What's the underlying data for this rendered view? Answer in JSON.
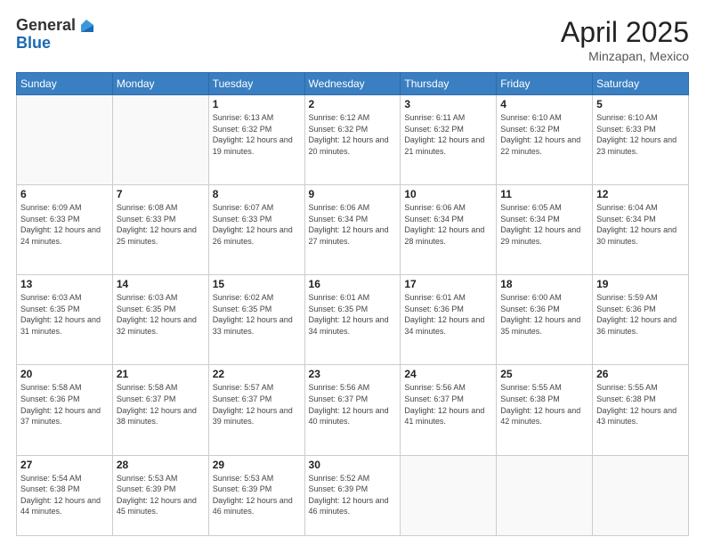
{
  "header": {
    "logo_line1": "General",
    "logo_line2": "Blue",
    "title": "April 2025",
    "location": "Minzapan, Mexico"
  },
  "days_of_week": [
    "Sunday",
    "Monday",
    "Tuesday",
    "Wednesday",
    "Thursday",
    "Friday",
    "Saturday"
  ],
  "weeks": [
    [
      {
        "day": null,
        "sunrise": null,
        "sunset": null,
        "daylight": null
      },
      {
        "day": null,
        "sunrise": null,
        "sunset": null,
        "daylight": null
      },
      {
        "day": "1",
        "sunrise": "Sunrise: 6:13 AM",
        "sunset": "Sunset: 6:32 PM",
        "daylight": "Daylight: 12 hours and 19 minutes."
      },
      {
        "day": "2",
        "sunrise": "Sunrise: 6:12 AM",
        "sunset": "Sunset: 6:32 PM",
        "daylight": "Daylight: 12 hours and 20 minutes."
      },
      {
        "day": "3",
        "sunrise": "Sunrise: 6:11 AM",
        "sunset": "Sunset: 6:32 PM",
        "daylight": "Daylight: 12 hours and 21 minutes."
      },
      {
        "day": "4",
        "sunrise": "Sunrise: 6:10 AM",
        "sunset": "Sunset: 6:32 PM",
        "daylight": "Daylight: 12 hours and 22 minutes."
      },
      {
        "day": "5",
        "sunrise": "Sunrise: 6:10 AM",
        "sunset": "Sunset: 6:33 PM",
        "daylight": "Daylight: 12 hours and 23 minutes."
      }
    ],
    [
      {
        "day": "6",
        "sunrise": "Sunrise: 6:09 AM",
        "sunset": "Sunset: 6:33 PM",
        "daylight": "Daylight: 12 hours and 24 minutes."
      },
      {
        "day": "7",
        "sunrise": "Sunrise: 6:08 AM",
        "sunset": "Sunset: 6:33 PM",
        "daylight": "Daylight: 12 hours and 25 minutes."
      },
      {
        "day": "8",
        "sunrise": "Sunrise: 6:07 AM",
        "sunset": "Sunset: 6:33 PM",
        "daylight": "Daylight: 12 hours and 26 minutes."
      },
      {
        "day": "9",
        "sunrise": "Sunrise: 6:06 AM",
        "sunset": "Sunset: 6:34 PM",
        "daylight": "Daylight: 12 hours and 27 minutes."
      },
      {
        "day": "10",
        "sunrise": "Sunrise: 6:06 AM",
        "sunset": "Sunset: 6:34 PM",
        "daylight": "Daylight: 12 hours and 28 minutes."
      },
      {
        "day": "11",
        "sunrise": "Sunrise: 6:05 AM",
        "sunset": "Sunset: 6:34 PM",
        "daylight": "Daylight: 12 hours and 29 minutes."
      },
      {
        "day": "12",
        "sunrise": "Sunrise: 6:04 AM",
        "sunset": "Sunset: 6:34 PM",
        "daylight": "Daylight: 12 hours and 30 minutes."
      }
    ],
    [
      {
        "day": "13",
        "sunrise": "Sunrise: 6:03 AM",
        "sunset": "Sunset: 6:35 PM",
        "daylight": "Daylight: 12 hours and 31 minutes."
      },
      {
        "day": "14",
        "sunrise": "Sunrise: 6:03 AM",
        "sunset": "Sunset: 6:35 PM",
        "daylight": "Daylight: 12 hours and 32 minutes."
      },
      {
        "day": "15",
        "sunrise": "Sunrise: 6:02 AM",
        "sunset": "Sunset: 6:35 PM",
        "daylight": "Daylight: 12 hours and 33 minutes."
      },
      {
        "day": "16",
        "sunrise": "Sunrise: 6:01 AM",
        "sunset": "Sunset: 6:35 PM",
        "daylight": "Daylight: 12 hours and 34 minutes."
      },
      {
        "day": "17",
        "sunrise": "Sunrise: 6:01 AM",
        "sunset": "Sunset: 6:36 PM",
        "daylight": "Daylight: 12 hours and 34 minutes."
      },
      {
        "day": "18",
        "sunrise": "Sunrise: 6:00 AM",
        "sunset": "Sunset: 6:36 PM",
        "daylight": "Daylight: 12 hours and 35 minutes."
      },
      {
        "day": "19",
        "sunrise": "Sunrise: 5:59 AM",
        "sunset": "Sunset: 6:36 PM",
        "daylight": "Daylight: 12 hours and 36 minutes."
      }
    ],
    [
      {
        "day": "20",
        "sunrise": "Sunrise: 5:58 AM",
        "sunset": "Sunset: 6:36 PM",
        "daylight": "Daylight: 12 hours and 37 minutes."
      },
      {
        "day": "21",
        "sunrise": "Sunrise: 5:58 AM",
        "sunset": "Sunset: 6:37 PM",
        "daylight": "Daylight: 12 hours and 38 minutes."
      },
      {
        "day": "22",
        "sunrise": "Sunrise: 5:57 AM",
        "sunset": "Sunset: 6:37 PM",
        "daylight": "Daylight: 12 hours and 39 minutes."
      },
      {
        "day": "23",
        "sunrise": "Sunrise: 5:56 AM",
        "sunset": "Sunset: 6:37 PM",
        "daylight": "Daylight: 12 hours and 40 minutes."
      },
      {
        "day": "24",
        "sunrise": "Sunrise: 5:56 AM",
        "sunset": "Sunset: 6:37 PM",
        "daylight": "Daylight: 12 hours and 41 minutes."
      },
      {
        "day": "25",
        "sunrise": "Sunrise: 5:55 AM",
        "sunset": "Sunset: 6:38 PM",
        "daylight": "Daylight: 12 hours and 42 minutes."
      },
      {
        "day": "26",
        "sunrise": "Sunrise: 5:55 AM",
        "sunset": "Sunset: 6:38 PM",
        "daylight": "Daylight: 12 hours and 43 minutes."
      }
    ],
    [
      {
        "day": "27",
        "sunrise": "Sunrise: 5:54 AM",
        "sunset": "Sunset: 6:38 PM",
        "daylight": "Daylight: 12 hours and 44 minutes."
      },
      {
        "day": "28",
        "sunrise": "Sunrise: 5:53 AM",
        "sunset": "Sunset: 6:39 PM",
        "daylight": "Daylight: 12 hours and 45 minutes."
      },
      {
        "day": "29",
        "sunrise": "Sunrise: 5:53 AM",
        "sunset": "Sunset: 6:39 PM",
        "daylight": "Daylight: 12 hours and 46 minutes."
      },
      {
        "day": "30",
        "sunrise": "Sunrise: 5:52 AM",
        "sunset": "Sunset: 6:39 PM",
        "daylight": "Daylight: 12 hours and 46 minutes."
      },
      {
        "day": null,
        "sunrise": null,
        "sunset": null,
        "daylight": null
      },
      {
        "day": null,
        "sunrise": null,
        "sunset": null,
        "daylight": null
      },
      {
        "day": null,
        "sunrise": null,
        "sunset": null,
        "daylight": null
      }
    ]
  ]
}
